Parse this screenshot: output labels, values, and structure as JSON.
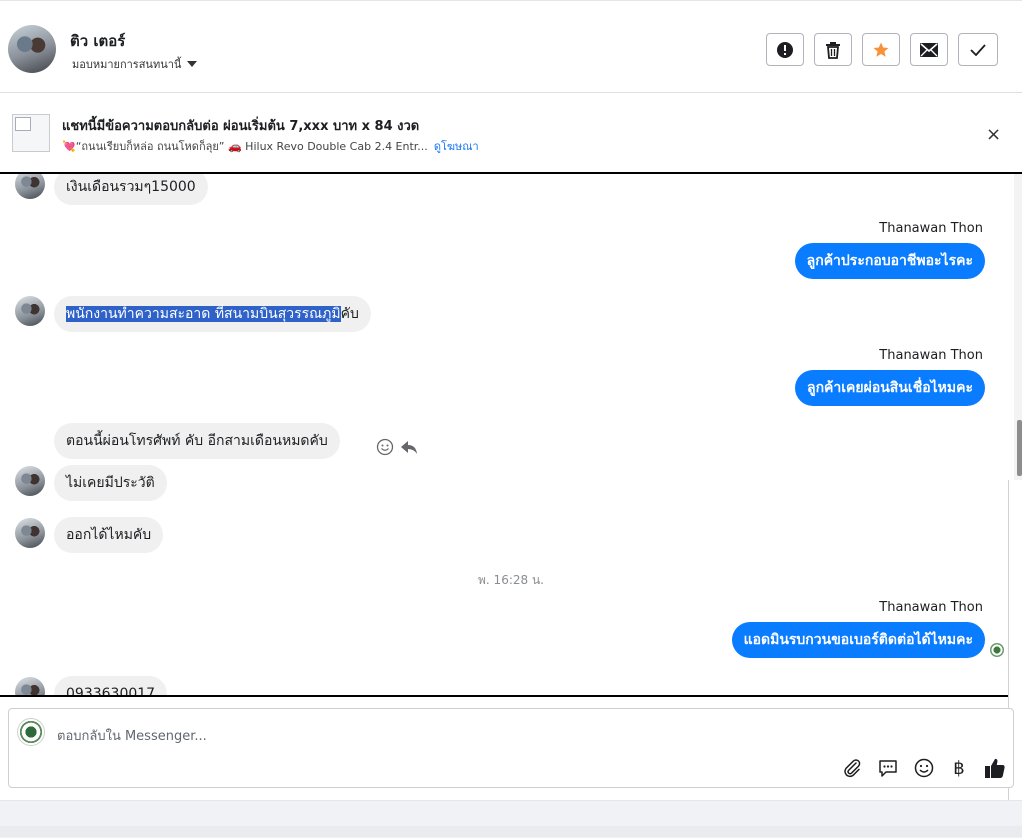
{
  "header": {
    "user_name": "ติว เตอร์",
    "assign_label": "มอบหมายการสนทนานี้",
    "buttons": [
      "report-icon",
      "trash-icon",
      "star-icon",
      "mail-icon",
      "check-icon"
    ]
  },
  "banner": {
    "title": "แชทนี้มีข้อความตอบกลับต่อ ผ่อนเริ่มต้น 7,xxx บาท x 84 งวด",
    "subtitle": "💘“ถนนเรียบก็หล่อ ถนนโหดก็ลุย” 🚗 Hilux Revo Double Cab 2.4 Entr...",
    "link": "ดูโฆษณา",
    "close": "×"
  },
  "messages": {
    "m1": "เงินเดือนรวมๆ15000",
    "sender1": "Thanawan Thon",
    "m2": "ลูกค้าประกอบอาชีพอะไรคะ",
    "m3_highlight": "พนักงานทำความสะอาด ที่สนามบินสุวรรณภูมิ",
    "m3_rest": "คับ",
    "sender2": "Thanawan Thon",
    "m4": "ลูกค้าเคยผ่อนสินเชื่อไหมคะ",
    "m5": "ตอนนี้ผ่อนโทรศัพท์ คับ อีกสามเดือนหมดคับ",
    "m6": "ไม่เคยมีประวัติ",
    "m7": "ออกได้ไหมคับ",
    "timestamp": "พ. 16:28 น.",
    "sender3": "Thanawan Thon",
    "m8": "แอดมินรบกวนขอเบอร์ติดต่อได้ไหมคะ",
    "m9": "0933630017"
  },
  "composer": {
    "placeholder": "ตอบกลับใน Messenger...",
    "tools": [
      "attach-icon",
      "saved-reply-icon",
      "emoji-icon",
      "baht-icon",
      "like-icon"
    ],
    "baht_symbol": "฿"
  },
  "colors": {
    "accent": "#0a7cff",
    "incoming_bubble": "#f0f0f0",
    "highlight": "#2f62c8",
    "star": "#f7923a"
  }
}
